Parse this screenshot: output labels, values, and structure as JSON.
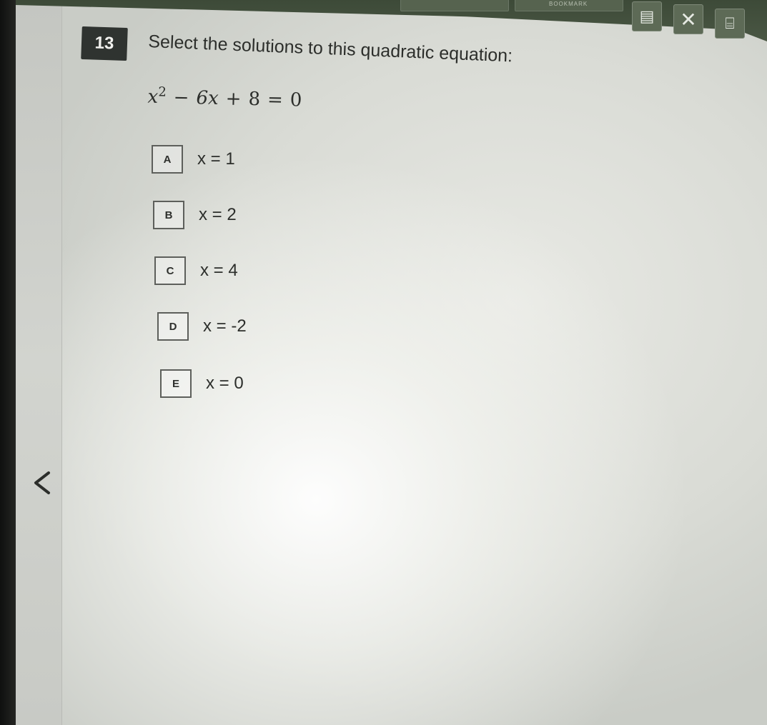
{
  "toolbar": {
    "header_label": "BOOKMARK",
    "buttons": [
      {
        "icon": "calculator-icon",
        "glyph": "▤"
      },
      {
        "icon": "close-icon",
        "glyph": "✕"
      },
      {
        "icon": "reference-icon",
        "glyph": "⌸"
      }
    ]
  },
  "question": {
    "number": "13",
    "prompt": "Select the solutions to this quadratic equation:",
    "equation": {
      "base": "x",
      "exponent": "2",
      "minus": "−",
      "term": "6x",
      "plus": "+",
      "constant": "8",
      "equals": "=",
      "rhs": "0"
    }
  },
  "choices": [
    {
      "letter": "A",
      "text": "x = 1"
    },
    {
      "letter": "B",
      "text": "x = 2"
    },
    {
      "letter": "C",
      "text": "x = 4"
    },
    {
      "letter": "D",
      "text": "x = -2"
    },
    {
      "letter": "E",
      "text": "x = 0"
    }
  ],
  "navigation": {
    "back_icon": "chevron-left-icon"
  },
  "colors": {
    "toolbar": "#4a5744",
    "badge": "#2f3330",
    "text": "#2c2e2b"
  }
}
